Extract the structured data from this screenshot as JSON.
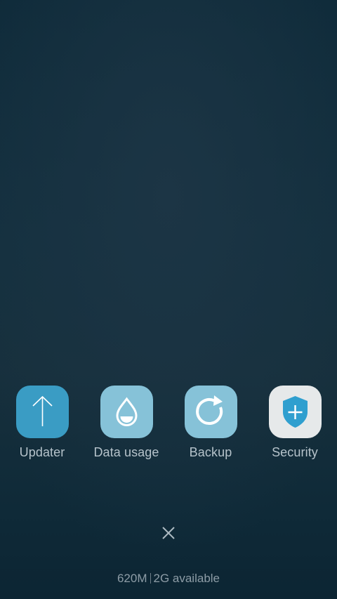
{
  "apps": [
    {
      "label": "Updater",
      "icon": "upload-arrow-icon",
      "color": "#3a9cc4"
    },
    {
      "label": "Data usage",
      "icon": "water-drop-icon",
      "color": "#86c2d8"
    },
    {
      "label": "Backup",
      "icon": "refresh-icon",
      "color": "#86c2d8"
    },
    {
      "label": "Security",
      "icon": "shield-plus-icon",
      "color": "#e6e9ea"
    }
  ],
  "close": {
    "icon": "close-icon"
  },
  "memory": {
    "used": "620M",
    "available": "2G available"
  }
}
